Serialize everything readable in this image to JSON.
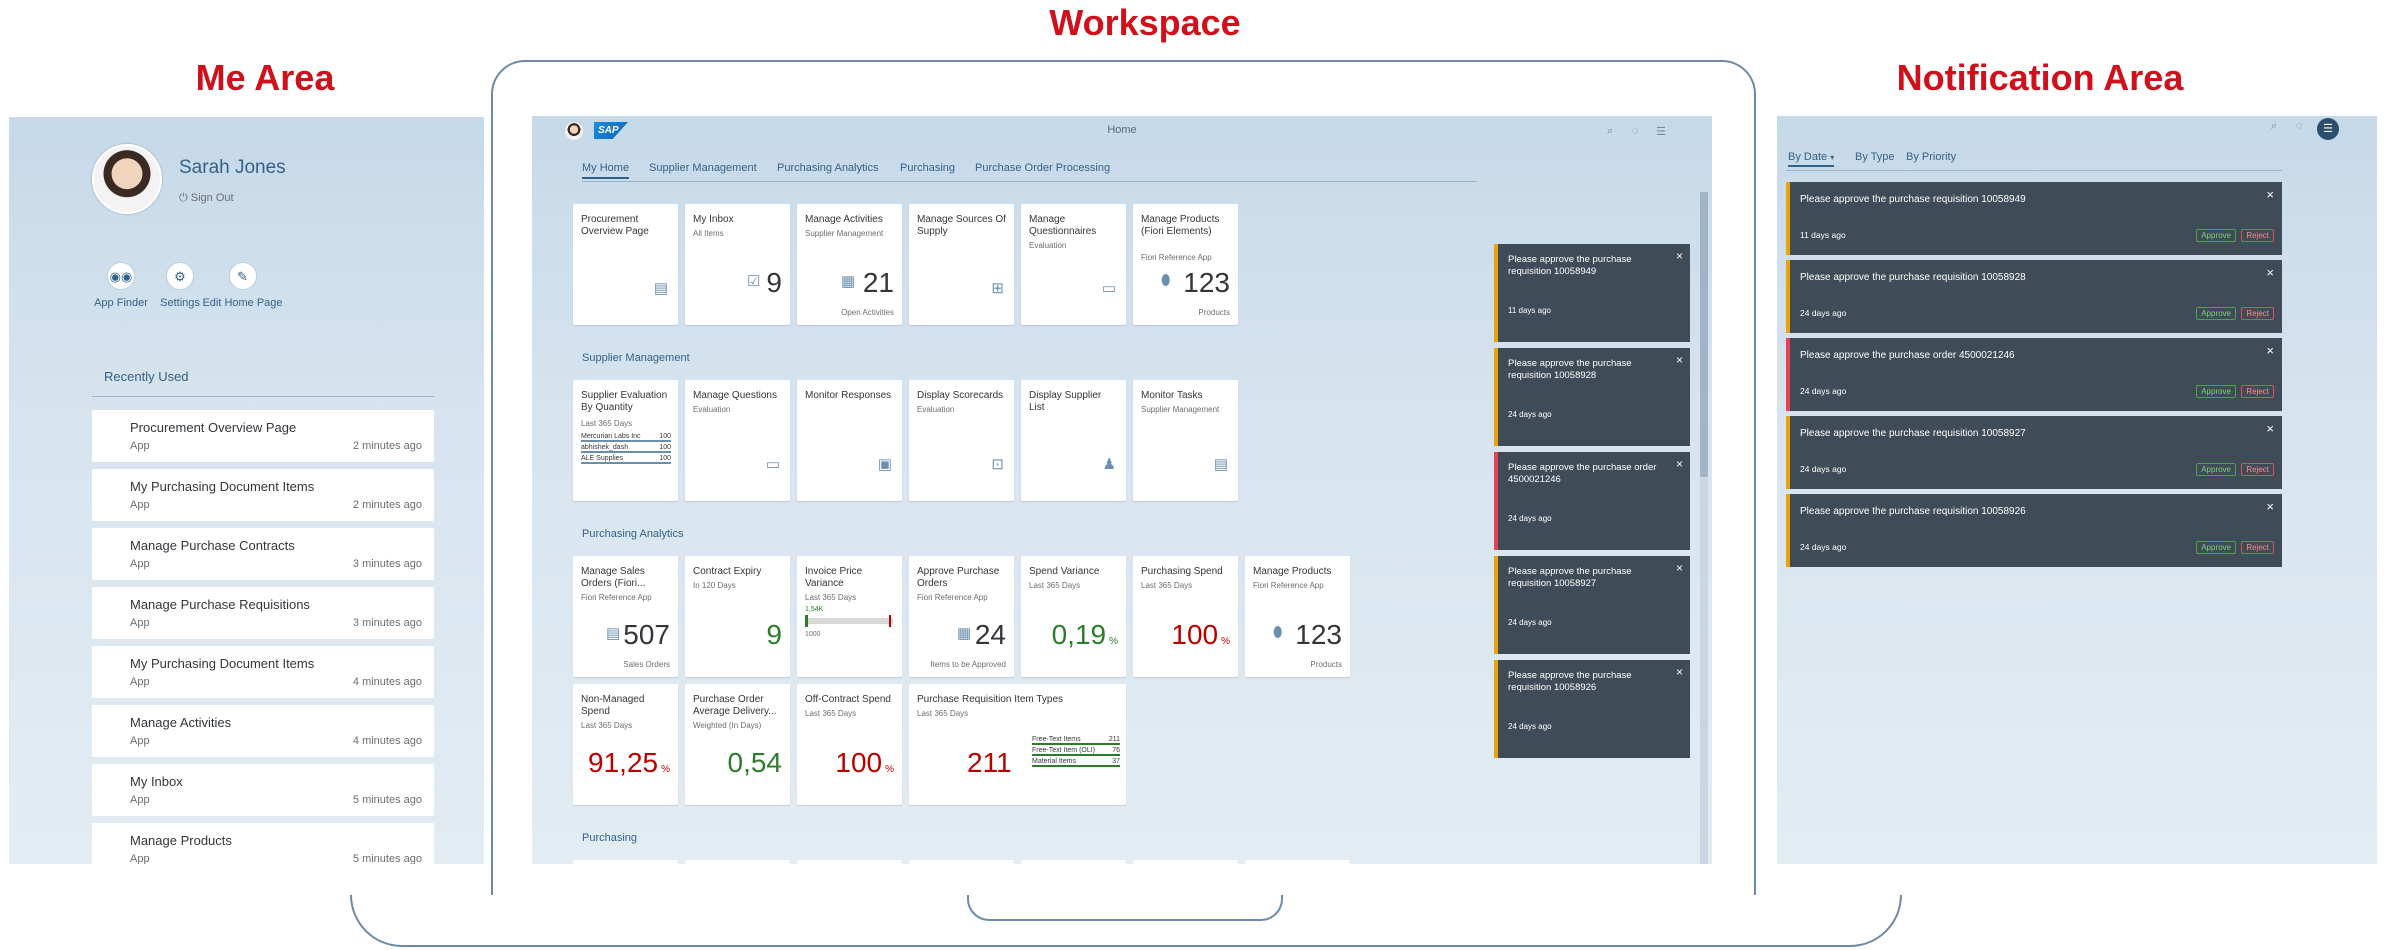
{
  "labels": {
    "workspace": "Workspace",
    "me_area": "Me Area",
    "notification_area": "Notification Area"
  },
  "me": {
    "name": "Sarah Jones",
    "sign_out": "Sign Out",
    "actions": [
      {
        "label": "App Finder",
        "icon": "binoculars-icon"
      },
      {
        "label": "Settings",
        "icon": "gear-icon"
      },
      {
        "label": "Edit Home Page",
        "icon": "pencil-icon"
      }
    ],
    "recently_used_title": "Recently Used",
    "recent": [
      {
        "title": "Procurement Overview Page",
        "type": "App",
        "when": "2 minutes ago"
      },
      {
        "title": "My Purchasing Document Items",
        "type": "App",
        "when": "2 minutes ago"
      },
      {
        "title": "Manage Purchase Contracts",
        "type": "App",
        "when": "3 minutes ago"
      },
      {
        "title": "Manage Purchase Requisitions",
        "type": "App",
        "when": "3 minutes ago"
      },
      {
        "title": "My Purchasing Document Items",
        "type": "App",
        "when": "4 minutes ago"
      },
      {
        "title": "Manage Activities",
        "type": "App",
        "when": "4 minutes ago"
      },
      {
        "title": "My Inbox",
        "type": "App",
        "when": "5 minutes ago"
      },
      {
        "title": "Manage Products",
        "type": "App",
        "when": "5 minutes ago"
      }
    ]
  },
  "shell": {
    "title": "Home",
    "logo": "SAP"
  },
  "tabs": [
    "My Home",
    "Supplier Management",
    "Purchasing Analytics",
    "Purchasing",
    "Purchase Order Processing"
  ],
  "groups": [
    "Supplier Management",
    "Purchasing Analytics",
    "Purchasing"
  ],
  "tiles": {
    "home": [
      {
        "title": "Procurement Overview Page",
        "sub": "",
        "num": "",
        "foot": ""
      },
      {
        "title": "My Inbox",
        "sub": "All Items",
        "num": "9",
        "foot": ""
      },
      {
        "title": "Manage Activities",
        "sub": "Supplier Management",
        "num": "21",
        "foot": "Open Activities"
      },
      {
        "title": "Manage Sources Of Supply",
        "sub": "",
        "num": "",
        "foot": ""
      },
      {
        "title": "Manage Questionnaires",
        "sub": "Evaluation",
        "num": "",
        "foot": ""
      },
      {
        "title": "Manage Products (Fiori Elements)",
        "sub": "Fiori Reference App",
        "num": "123",
        "foot": "Products"
      }
    ],
    "supplier": [
      {
        "title": "Supplier Evaluation By Quantity",
        "sub": "Last 365 Days",
        "num": "",
        "foot": ""
      },
      {
        "title": "Manage Questions",
        "sub": "Evaluation",
        "num": "",
        "foot": ""
      },
      {
        "title": "Monitor Responses",
        "sub": "",
        "num": "",
        "foot": ""
      },
      {
        "title": "Display Scorecards",
        "sub": "Evaluation",
        "num": "",
        "foot": ""
      },
      {
        "title": "Display Supplier List",
        "sub": "",
        "num": "",
        "foot": ""
      },
      {
        "title": "Monitor Tasks",
        "sub": "Supplier Management",
        "num": "",
        "foot": ""
      }
    ],
    "supplier_eval_rows": [
      {
        "name": "Mercurian Labs Inc",
        "value": "100"
      },
      {
        "name": "abhishek_dash",
        "value": "100"
      },
      {
        "name": "ALE Supplies",
        "value": "100"
      }
    ],
    "analytics1": [
      {
        "title": "Manage Sales Orders (Fiori...",
        "sub": "Fiori Reference App",
        "num": "507",
        "foot": "Sales Orders"
      },
      {
        "title": "Contract Expiry",
        "sub": "In 120 Days",
        "num": "9",
        "foot": ""
      },
      {
        "title": "Invoice Price Variance",
        "sub": "Last 365 Days",
        "num": "",
        "foot": ""
      },
      {
        "title": "Approve Purchase Orders",
        "sub": "Fiori Reference App",
        "num": "24",
        "foot": "Items to be Approved"
      },
      {
        "title": "Spend Variance",
        "sub": "Last 365 Days",
        "num": "0,19",
        "unit": "%",
        "foot": ""
      },
      {
        "title": "Purchasing Spend",
        "sub": "Last 365 Days",
        "num": "100",
        "unit": "%",
        "foot": ""
      },
      {
        "title": "Manage Products",
        "sub": "Fiori Reference App",
        "num": "123",
        "foot": "Products"
      }
    ],
    "invoice_bullet": {
      "value": "1,54K",
      "target": "1000"
    },
    "analytics2": [
      {
        "title": "Non-Managed Spend",
        "sub": "Last 365 Days",
        "num": "91,25",
        "unit": "%",
        "foot": ""
      },
      {
        "title": "Purchase Order Average Delivery...",
        "sub": "Weighted (In Days)",
        "num": "0,54",
        "foot": ""
      },
      {
        "title": "Off-Contract Spend",
        "sub": "Last 365 Days",
        "num": "100",
        "unit": "%",
        "foot": ""
      },
      {
        "title": "Purchase Requisition Item Types",
        "sub": "Last 365 Days",
        "num": "211",
        "foot": ""
      }
    ],
    "pr_item_types": [
      {
        "name": "Free-Text Items",
        "value": "211"
      },
      {
        "name": "Free-Text Item (OLI)",
        "value": "76"
      },
      {
        "name": "Material Items",
        "value": "37"
      }
    ]
  },
  "screen_notifications": [
    {
      "msg": "Please approve the purchase requisition 10058949",
      "age": "11 days ago",
      "accent": "#e9a20a"
    },
    {
      "msg": "Please approve the purchase requisition 10058928",
      "age": "24 days ago",
      "accent": "#e9a20a"
    },
    {
      "msg": "Please approve the purchase order 4500021246",
      "age": "24 days ago",
      "accent": "#e34352"
    },
    {
      "msg": "Please approve the purchase requisition 10058927",
      "age": "24 days ago",
      "accent": "#e9a20a"
    },
    {
      "msg": "Please approve the purchase requisition 10058926",
      "age": "24 days ago",
      "accent": "#e9a20a"
    }
  ],
  "notif_filters": [
    "By Date",
    "By Type",
    "By Priority"
  ],
  "notifications": [
    {
      "msg": "Please approve the purchase requisition 10058949",
      "age": "11 days ago",
      "accent": "#e9a20a"
    },
    {
      "msg": "Please approve the purchase requisition 10058928",
      "age": "24 days ago",
      "accent": "#e9a20a"
    },
    {
      "msg": "Please approve the purchase order 4500021246",
      "age": "24 days ago",
      "accent": "#e34352"
    },
    {
      "msg": "Please approve the purchase requisition 10058927",
      "age": "24 days ago",
      "accent": "#e9a20a"
    },
    {
      "msg": "Please approve the purchase requisition 10058926",
      "age": "24 days ago",
      "accent": "#e9a20a"
    }
  ],
  "buttons": {
    "approve": "Approve",
    "reject": "Reject",
    "close": "×"
  }
}
